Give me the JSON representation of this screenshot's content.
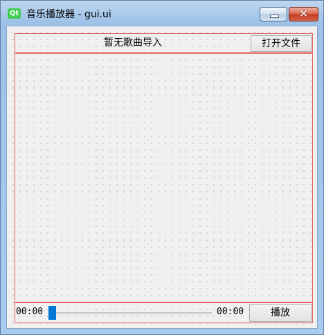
{
  "window": {
    "title": "音乐播放器 - gui.ui",
    "logo_text": "Qt",
    "minimize_label": "",
    "close_label": "✕"
  },
  "top_bar": {
    "status_text": "暂无歌曲导入",
    "open_button_label": "打开文件"
  },
  "playlist": {
    "items": []
  },
  "player": {
    "current_time": "00:00",
    "total_time": "00:00",
    "progress": 0,
    "play_button_label": "播放"
  },
  "colors": {
    "layout_outline": "#e45d5d",
    "slider_handle": "#0078d7",
    "qt_logo": "#41cd52"
  }
}
